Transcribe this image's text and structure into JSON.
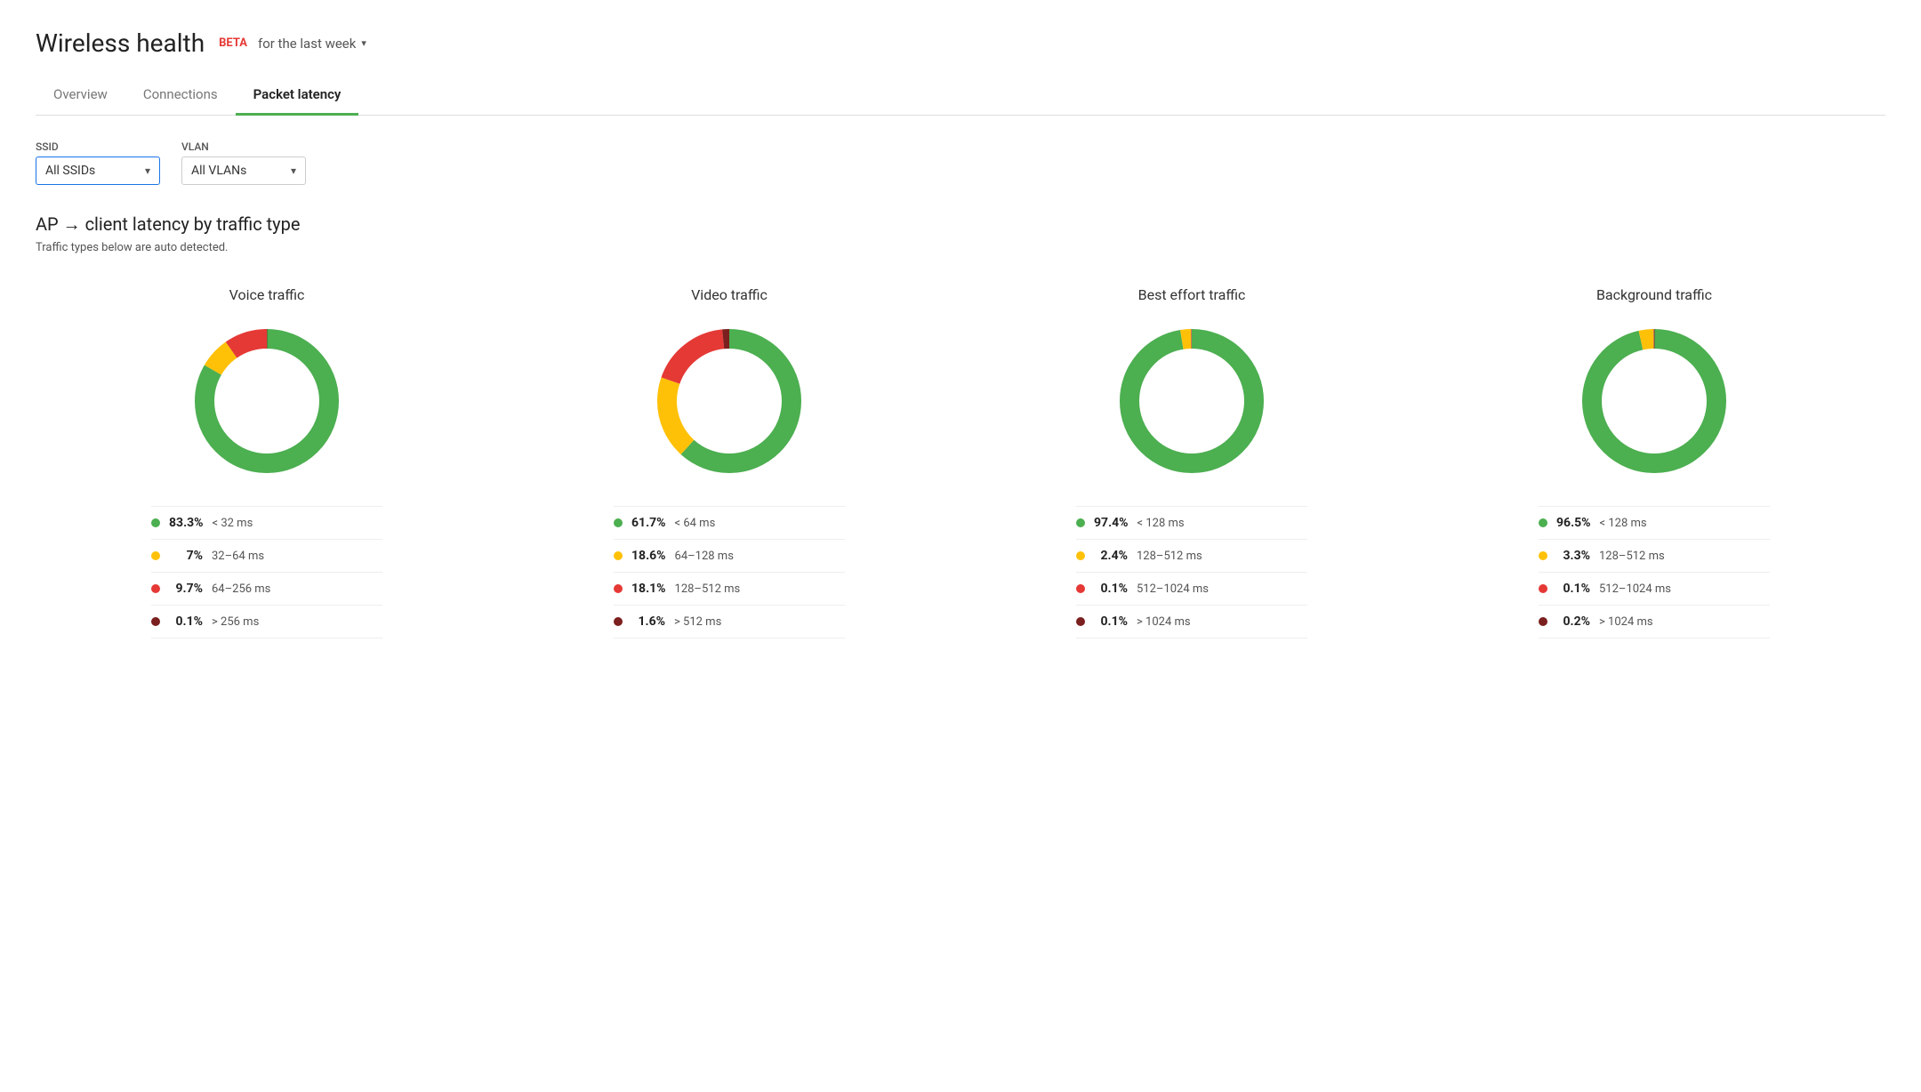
{
  "header": {
    "title": "Wireless health",
    "beta": "BETA",
    "time_label": "for the last week",
    "dropdown_arrow": "▾"
  },
  "tabs": [
    {
      "id": "overview",
      "label": "Overview",
      "active": false
    },
    {
      "id": "connections",
      "label": "Connections",
      "active": false
    },
    {
      "id": "packet-latency",
      "label": "Packet latency",
      "active": true
    }
  ],
  "filters": {
    "ssid": {
      "label": "SSID",
      "value": "All SSIDs",
      "arrow": "▾"
    },
    "vlan": {
      "label": "VLAN",
      "value": "All VLANs",
      "arrow": "▾"
    }
  },
  "section": {
    "title": "AP → client latency by traffic type",
    "subtitle": "Traffic types below are auto detected."
  },
  "charts": [
    {
      "id": "voice",
      "title": "Voice traffic",
      "segments": [
        {
          "color": "#4caf50",
          "pct": 83.3,
          "degrees": 299.88
        },
        {
          "color": "#ffc107",
          "pct": 7.0,
          "degrees": 25.2
        },
        {
          "color": "#e53935",
          "pct": 9.7,
          "degrees": 34.92
        },
        {
          "color": "#7b1f1f",
          "pct": 0.1,
          "degrees": 0.36
        }
      ],
      "legend": [
        {
          "color": "#4caf50",
          "pct": "83.3%",
          "range": "< 32 ms"
        },
        {
          "color": "#ffc107",
          "pct": "7%",
          "range": "32–64 ms"
        },
        {
          "color": "#e53935",
          "pct": "9.7%",
          "range": "64–256 ms"
        },
        {
          "color": "#7b1f1f",
          "pct": "0.1%",
          "range": "> 256 ms"
        }
      ]
    },
    {
      "id": "video",
      "title": "Video traffic",
      "segments": [
        {
          "color": "#4caf50",
          "pct": 61.7,
          "degrees": 222.12
        },
        {
          "color": "#ffc107",
          "pct": 18.6,
          "degrees": 66.96
        },
        {
          "color": "#e53935",
          "pct": 18.1,
          "degrees": 65.16
        },
        {
          "color": "#7b1f1f",
          "pct": 1.6,
          "degrees": 5.76
        }
      ],
      "legend": [
        {
          "color": "#4caf50",
          "pct": "61.7%",
          "range": "< 64 ms"
        },
        {
          "color": "#ffc107",
          "pct": "18.6%",
          "range": "64–128 ms"
        },
        {
          "color": "#e53935",
          "pct": "18.1%",
          "range": "128–512 ms"
        },
        {
          "color": "#7b1f1f",
          "pct": "1.6%",
          "range": "> 512 ms"
        }
      ]
    },
    {
      "id": "best-effort",
      "title": "Best effort traffic",
      "segments": [
        {
          "color": "#4caf50",
          "pct": 97.4,
          "degrees": 350.64
        },
        {
          "color": "#ffc107",
          "pct": 2.4,
          "degrees": 8.64
        },
        {
          "color": "#e53935",
          "pct": 0.1,
          "degrees": 0.36
        },
        {
          "color": "#7b1f1f",
          "pct": 0.1,
          "degrees": 0.36
        }
      ],
      "legend": [
        {
          "color": "#4caf50",
          "pct": "97.4%",
          "range": "< 128 ms"
        },
        {
          "color": "#ffc107",
          "pct": "2.4%",
          "range": "128–512 ms"
        },
        {
          "color": "#e53935",
          "pct": "0.1%",
          "range": "512–1024 ms"
        },
        {
          "color": "#7b1f1f",
          "pct": "0.1%",
          "range": "> 1024 ms"
        }
      ]
    },
    {
      "id": "background",
      "title": "Background traffic",
      "segments": [
        {
          "color": "#4caf50",
          "pct": 96.5,
          "degrees": 347.4
        },
        {
          "color": "#ffc107",
          "pct": 3.3,
          "degrees": 11.88
        },
        {
          "color": "#e53935",
          "pct": 0.1,
          "degrees": 0.36
        },
        {
          "color": "#7b1f1f",
          "pct": 0.2,
          "degrees": 0.72
        }
      ],
      "legend": [
        {
          "color": "#4caf50",
          "pct": "96.5%",
          "range": "< 128 ms"
        },
        {
          "color": "#ffc107",
          "pct": "3.3%",
          "range": "128–512 ms"
        },
        {
          "color": "#e53935",
          "pct": "0.1%",
          "range": "512–1024 ms"
        },
        {
          "color": "#7b1f1f",
          "pct": "0.2%",
          "range": "> 1024 ms"
        }
      ]
    }
  ]
}
